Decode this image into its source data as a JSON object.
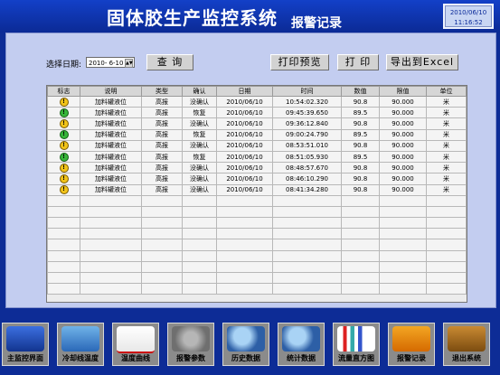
{
  "header": {
    "title": "固体胶生产监控系统",
    "subtitle": "报警记录",
    "clock_date": "2010/06/10",
    "clock_time": "11:16:52"
  },
  "filter": {
    "date_label": "选择日期:",
    "date_value": "2010- 6-10",
    "query_label": "查 询"
  },
  "toolbar": {
    "preview_label": "打印预览",
    "print_label": "打 印",
    "export_label": "导出到Excel"
  },
  "table": {
    "headers": [
      "标志",
      "说明",
      "类型",
      "确认",
      "日期",
      "时间",
      "数值",
      "限值",
      "单位"
    ],
    "rows": [
      {
        "status": "warn",
        "desc": "加料罐液位",
        "type": "高报",
        "confirm": "没确认",
        "date": "2010/06/10",
        "time": "10:54:02.320",
        "value": "90.8",
        "limit": "90.000",
        "unit": "米"
      },
      {
        "status": "ok",
        "desc": "加料罐液位",
        "type": "高报",
        "confirm": "恢复",
        "date": "2010/06/10",
        "time": "09:45:39.650",
        "value": "89.5",
        "limit": "90.000",
        "unit": "米"
      },
      {
        "status": "warn",
        "desc": "加料罐液位",
        "type": "高报",
        "confirm": "没确认",
        "date": "2010/06/10",
        "time": "09:36:12.840",
        "value": "90.8",
        "limit": "90.000",
        "unit": "米"
      },
      {
        "status": "ok",
        "desc": "加料罐液位",
        "type": "高报",
        "confirm": "恢复",
        "date": "2010/06/10",
        "time": "09:00:24.790",
        "value": "89.5",
        "limit": "90.000",
        "unit": "米"
      },
      {
        "status": "warn",
        "desc": "加料罐液位",
        "type": "高报",
        "confirm": "没确认",
        "date": "2010/06/10",
        "time": "08:53:51.010",
        "value": "90.8",
        "limit": "90.000",
        "unit": "米"
      },
      {
        "status": "ok",
        "desc": "加料罐液位",
        "type": "高报",
        "confirm": "恢复",
        "date": "2010/06/10",
        "time": "08:51:05.930",
        "value": "89.5",
        "limit": "90.000",
        "unit": "米"
      },
      {
        "status": "warn",
        "desc": "加料罐液位",
        "type": "高报",
        "confirm": "没确认",
        "date": "2010/06/10",
        "time": "08:48:57.670",
        "value": "90.8",
        "limit": "90.000",
        "unit": "米"
      },
      {
        "status": "warn",
        "desc": "加料罐液位",
        "type": "高报",
        "confirm": "没确认",
        "date": "2010/06/10",
        "time": "08:46:10.290",
        "value": "90.8",
        "limit": "90.000",
        "unit": "米"
      },
      {
        "status": "warn",
        "desc": "加料罐液位",
        "type": "高报",
        "confirm": "没确认",
        "date": "2010/06/10",
        "time": "08:41:34.280",
        "value": "90.8",
        "limit": "90.000",
        "unit": "米"
      }
    ],
    "status_icons": {
      "warn": "exclamation-warning-icon",
      "ok": "exclamation-ok-icon"
    }
  },
  "nav": [
    {
      "label": "主监控界面",
      "icon": "monitor-icon"
    },
    {
      "label": "冷却线温度",
      "icon": "temperature-icon"
    },
    {
      "label": "温度曲线",
      "icon": "line-chart-icon"
    },
    {
      "label": "报警参数",
      "icon": "gear-icon"
    },
    {
      "label": "历史数据",
      "icon": "magnifier-icon"
    },
    {
      "label": "统计数据",
      "icon": "magnifier-icon"
    },
    {
      "label": "流量直方图",
      "icon": "bar-chart-icon"
    },
    {
      "label": "报警记录",
      "icon": "warning-icon"
    },
    {
      "label": "退出系统",
      "icon": "exit-door-icon"
    }
  ],
  "colors": {
    "background": "#0d2c96",
    "panel": "#c3cdf0",
    "warn": "#f1c31a",
    "ok": "#37b53a"
  }
}
